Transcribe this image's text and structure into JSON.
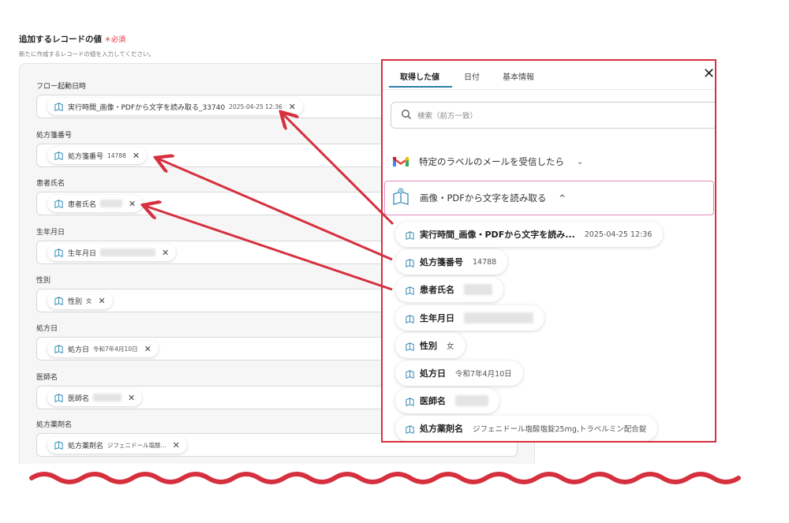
{
  "section": {
    "title": "追加するレコードの値",
    "required": "＊必須",
    "description": "新たに作成するレコードの値を入力してください。"
  },
  "fields": [
    {
      "label": "フロー起動日時",
      "token": "実行時間_画像・PDFから文字を読み取る_33740",
      "value": "2025-04-25 12:36"
    },
    {
      "label": "処方箋番号",
      "token": "処方箋番号",
      "value": "14788"
    },
    {
      "label": "患者氏名",
      "token": "患者氏名",
      "value": ""
    },
    {
      "label": "生年月日",
      "token": "生年月日",
      "value": ""
    },
    {
      "label": "性別",
      "token": "性別",
      "value": "女"
    },
    {
      "label": "処方日",
      "token": "処方日",
      "value": "令和7年4月10日"
    },
    {
      "label": "医師名",
      "token": "医師名",
      "value": ""
    },
    {
      "label": "処方薬剤名",
      "token": "処方薬剤名",
      "value": "ジフェニドール塩酸..."
    }
  ],
  "popup": {
    "tabs": [
      "取得した値",
      "日付",
      "基本情報"
    ],
    "close": "✕",
    "search_placeholder": "検索（前方一致）",
    "groups": [
      {
        "label": "特定のラベルのメールを受信したら",
        "icon": "gmail-icon",
        "chevron": "⌄"
      },
      {
        "label": "画像・PDFから文字を読み取る",
        "icon": "ocr-book-icon",
        "chevron": "^"
      }
    ],
    "items": [
      {
        "label": "実行時間_画像・PDFから文字を読み...",
        "value": "2025-04-25 12:36"
      },
      {
        "label": "処方箋番号",
        "value": "14788"
      },
      {
        "label": "患者氏名",
        "value": ""
      },
      {
        "label": "生年月日",
        "value": ""
      },
      {
        "label": "性別",
        "value": "女"
      },
      {
        "label": "処方日",
        "value": "令和7年4月10日"
      },
      {
        "label": "医師名",
        "value": ""
      },
      {
        "label": "処方薬剤名",
        "value": "ジフェニドール塩酸塩錠25mg,トラベルミン配合錠"
      }
    ]
  },
  "colors": {
    "highlight": "#d6303e",
    "arrow": "#d6303e",
    "tab_underline": "#2a7fa8",
    "group_selected": "#e08fc0"
  }
}
